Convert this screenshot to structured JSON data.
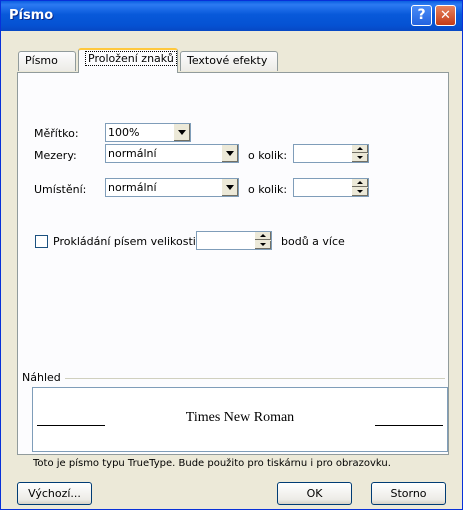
{
  "window": {
    "title": "Písmo"
  },
  "tabs": [
    {
      "label": "Písmo",
      "selected": false
    },
    {
      "label": "Proložení znaků",
      "selected": true
    },
    {
      "label": "Textové efekty",
      "selected": false
    }
  ],
  "fields": {
    "scale": {
      "label": "Měřítko:",
      "value": "100%"
    },
    "spacing": {
      "label": "Mezery:",
      "value": "normální",
      "by_label": "o kolik:",
      "by_value": ""
    },
    "position": {
      "label": "Umístění:",
      "value": "normální",
      "by_label": "o kolik:",
      "by_value": ""
    },
    "kerning": {
      "label": "Prokládání písem velikosti:",
      "checked": false,
      "value": "",
      "suffix": "bodů a více"
    }
  },
  "preview": {
    "group_label": "Náhled",
    "sample_text": "Times New Roman",
    "note": "Toto je písmo typu TrueType. Bude použito pro tiskárnu i pro obrazovku."
  },
  "buttons": {
    "default": "Výchozí...",
    "ok": "OK",
    "cancel": "Storno"
  },
  "colors": {
    "titlebar": "#0A5FE0",
    "dialog_bg": "#ECE9D8",
    "close_button": "#C33B17"
  },
  "icons": {
    "help": "help-icon",
    "close": "close-icon"
  }
}
